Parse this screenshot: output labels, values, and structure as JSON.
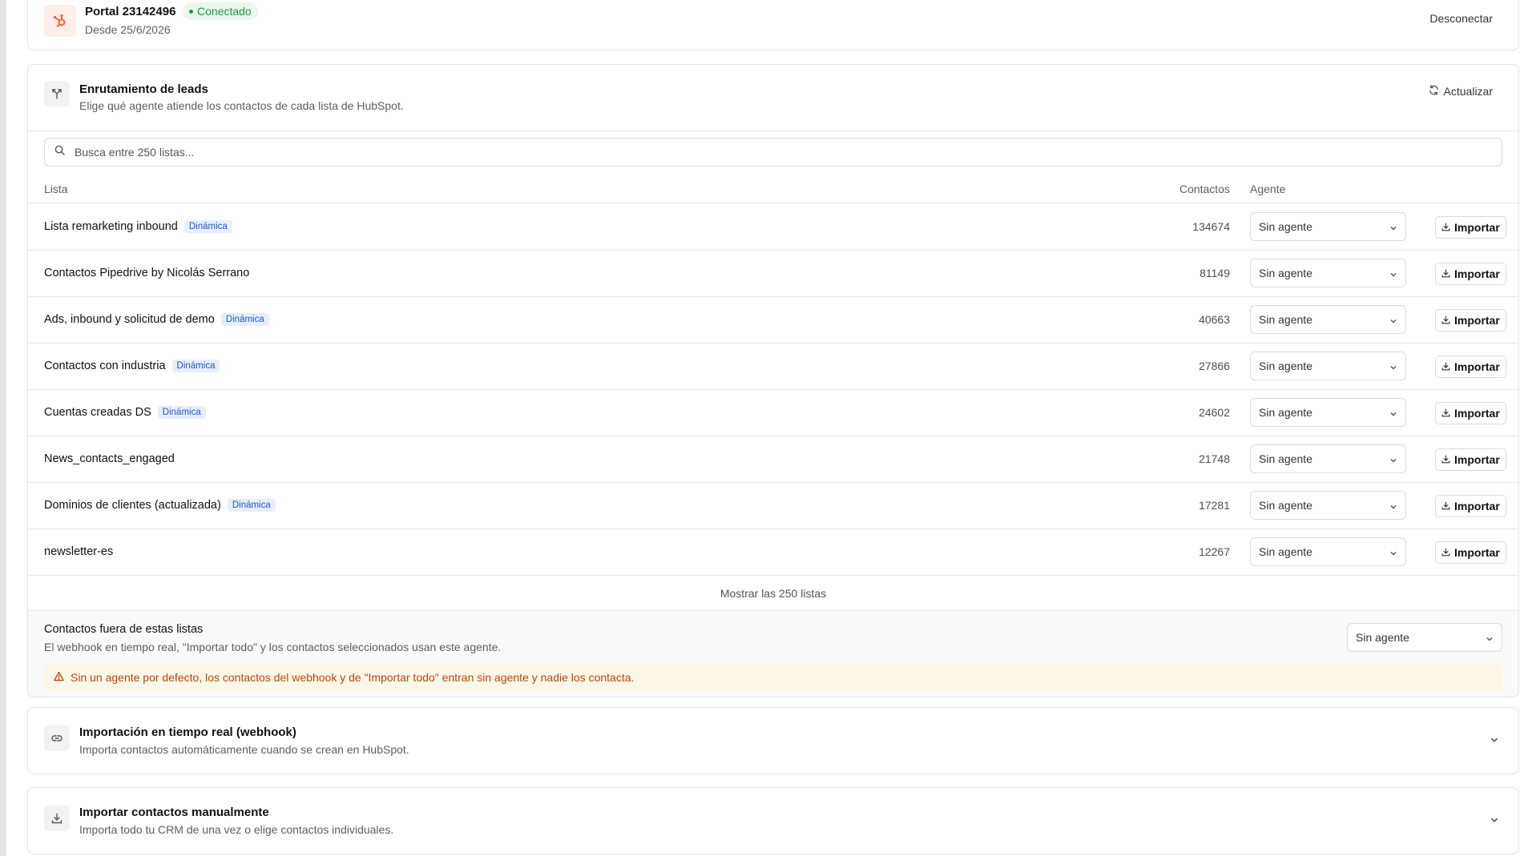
{
  "portal": {
    "title": "Portal 23142496",
    "status": "Conectado",
    "since": "Desde 25/6/2026",
    "disconnect_label": "Desconectar"
  },
  "routing": {
    "title": "Enrutamiento de leads",
    "subtitle": "Elige qué agente atiende los contactos de cada lista de HubSpot.",
    "refresh_label": "Actualizar",
    "search_placeholder": "Busca entre 250 listas...",
    "columns": {
      "list": "Lista",
      "contacts": "Contactos",
      "agent": "Agente"
    },
    "rows": [
      {
        "name": "Lista remarketing inbound",
        "badge": "Dinámica",
        "count": "134674",
        "agent": "Sin agente",
        "import_label": "Importar"
      },
      {
        "name": "Contactos Pipedrive by Nicolás Serrano",
        "badge": "",
        "count": "81149",
        "agent": "Sin agente",
        "import_label": "Importar"
      },
      {
        "name": "Ads, inbound y solicitud de demo",
        "badge": "Dinámica",
        "count": "40663",
        "agent": "Sin agente",
        "import_label": "Importar"
      },
      {
        "name": "Contactos con industria",
        "badge": "Dinámica",
        "count": "27866",
        "agent": "Sin agente",
        "import_label": "Importar"
      },
      {
        "name": "Cuentas creadas DS",
        "badge": "Dinámica",
        "count": "24602",
        "agent": "Sin agente",
        "import_label": "Importar"
      },
      {
        "name": "News_contacts_engaged",
        "badge": "",
        "count": "21748",
        "agent": "Sin agente",
        "import_label": "Importar"
      },
      {
        "name": "Dominios de clientes (actualizada)",
        "badge": "Dinámica",
        "count": "17281",
        "agent": "Sin agente",
        "import_label": "Importar"
      },
      {
        "name": "newsletter-es",
        "badge": "",
        "count": "12267",
        "agent": "Sin agente",
        "import_label": "Importar"
      }
    ],
    "show_all_label": "Mostrar las 250 listas",
    "outside": {
      "title": "Contactos fuera de estas listas",
      "subtitle": "El webhook en tiempo real, \"Importar todo\" y los contactos seleccionados usan este agente.",
      "agent": "Sin agente",
      "warning": "Sin un agente por defecto, los contactos del webhook y de \"Importar todo\" entran sin agente y nadie los contacta."
    }
  },
  "webhook": {
    "title": "Importación en tiempo real (webhook)",
    "subtitle": "Importa contactos automáticamente cuando se crean en HubSpot."
  },
  "manual": {
    "title": "Importar contactos manualmente",
    "subtitle": "Importa todo tu CRM de una vez o elige contactos individuales."
  },
  "colors": {
    "hubspot_orange": "#ff5c35",
    "connected_green": "#1e9a48",
    "badge_blue": "#2456d6",
    "warning_text": "#b5480d",
    "warning_bg": "#fdf7e9"
  },
  "icons": {
    "portal": "hubspot-icon",
    "routing": "route-split-icon",
    "refresh": "refresh-icon",
    "search": "search-icon",
    "import": "download-icon",
    "warning": "warning-icon",
    "webhook": "link-icon",
    "manual": "download-icon",
    "expand": "chevron-down-icon"
  }
}
